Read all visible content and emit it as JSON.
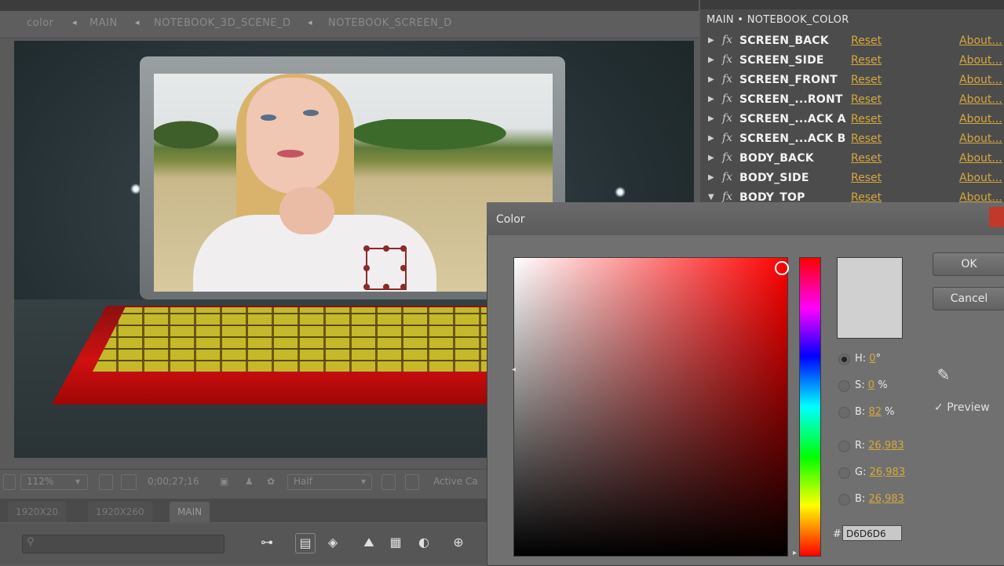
{
  "breadcrumb": {
    "items": [
      "color",
      "MAIN",
      "NOTEBOOK_3D_SCENE_D",
      "NOTEBOOK_SCREEN_D"
    ]
  },
  "viewer_toolbar": {
    "zoom": "112%",
    "timecode": "0;00;27;16",
    "resolution": "Half",
    "camera": "Active Ca"
  },
  "timeline": {
    "tabs": [
      "1920X20",
      "1920X260",
      "MAIN"
    ]
  },
  "effects_panel": {
    "header": "MAIN • NOTEBOOK_COLOR",
    "effects": [
      {
        "name": "SCREEN_BACK",
        "reset": "Reset",
        "about": "About..."
      },
      {
        "name": "SCREEN_SIDE",
        "reset": "Reset",
        "about": "About..."
      },
      {
        "name": "SCREEN_FRONT",
        "reset": "Reset",
        "about": "About..."
      },
      {
        "name": "SCREEN_...RONT",
        "reset": "Reset",
        "about": "About..."
      },
      {
        "name": "SCREEN_...ACK A",
        "reset": "Reset",
        "about": "About..."
      },
      {
        "name": "SCREEN_...ACK B",
        "reset": "Reset",
        "about": "About..."
      },
      {
        "name": "BODY_BACK",
        "reset": "Reset",
        "about": "About..."
      },
      {
        "name": "BODY_SIDE",
        "reset": "Reset",
        "about": "About..."
      },
      {
        "name": "BODY_TOP",
        "reset": "Reset",
        "about": "About..."
      }
    ]
  },
  "color_dialog": {
    "title": "Color",
    "ok_label": "OK",
    "cancel_label": "Cancel",
    "preview_label": "Preview",
    "fields": {
      "h_label": "H:",
      "h_value": "0",
      "h_unit": "°",
      "s_label": "S:",
      "s_value": "0",
      "s_unit": "%",
      "b_label": "B:",
      "b_value": "82",
      "b_unit": "%",
      "r_label": "R:",
      "r_value": "26,983",
      "g_label": "G:",
      "g_value": "26,983",
      "b2_label": "B:",
      "b2_value": "26,983"
    },
    "hex_symbol": "#",
    "hex_value": "D6D6D6",
    "new_color": "#d0d0d0"
  },
  "colors": {
    "accent_link": "#d6a73a",
    "laptop_body": "#d01010",
    "keyboard_keys": "#c5c22c"
  }
}
